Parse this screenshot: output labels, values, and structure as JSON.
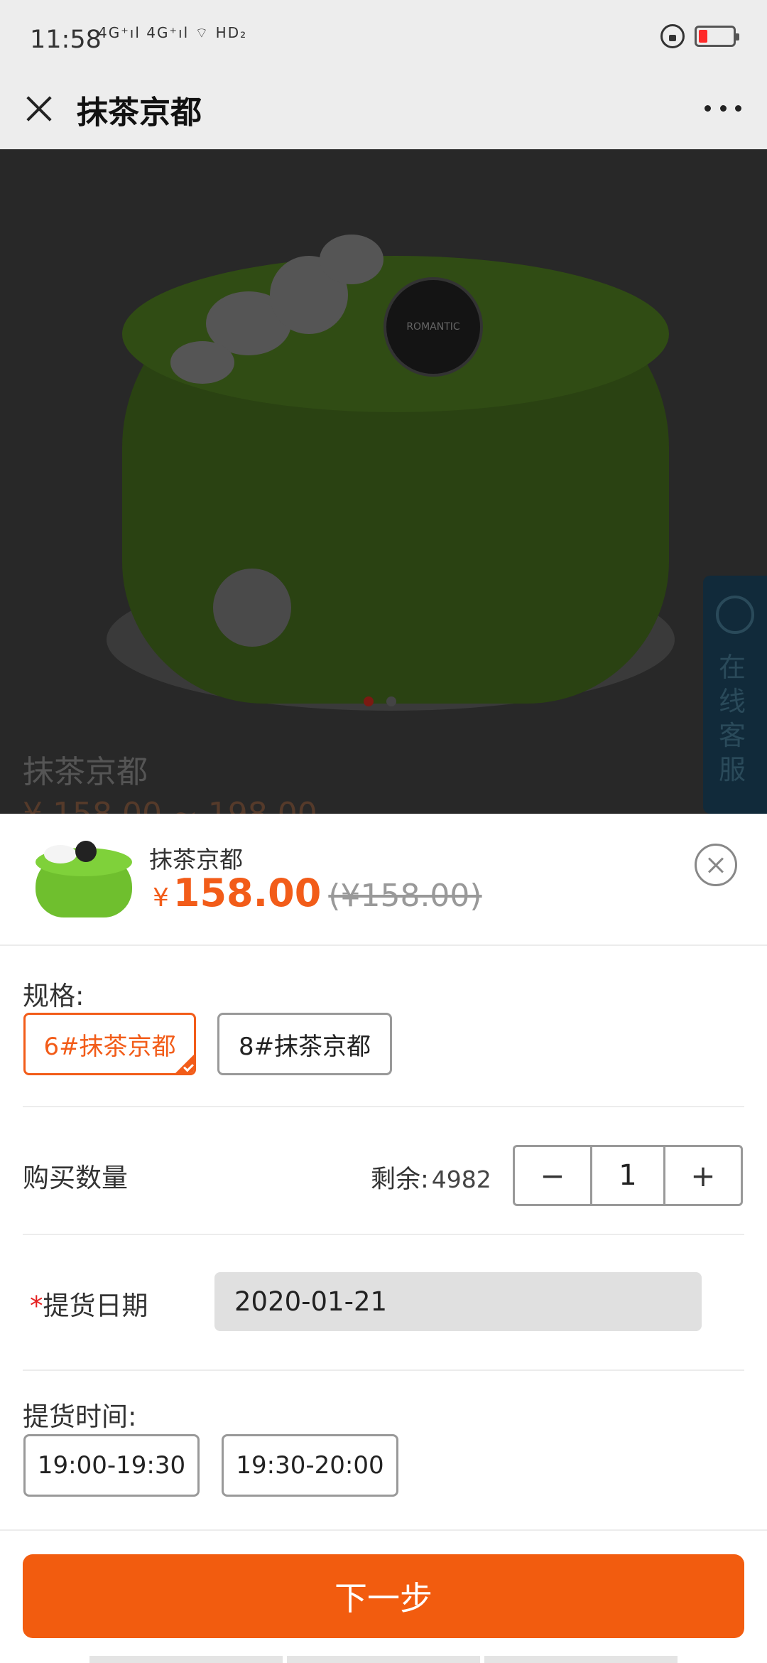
{
  "status_bar": {
    "time": "11:58",
    "signals": "4G⁺ıl 4G⁺ıl ⌔ HD₂",
    "battery_color": "#ff2a2a"
  },
  "header": {
    "title": "抹茶京都",
    "close_icon": "close-icon",
    "more_icon": "more-icon"
  },
  "hero": {
    "product_title": "抹茶京都",
    "price_partial": "¥ 158.00 ~ 198.00",
    "carousel_active_index": 0,
    "carousel_count": 2,
    "cake_logo_text": "ROMANTIC",
    "service_label": "在线客服"
  },
  "sheet": {
    "product_name": "抹茶京都",
    "currency": "¥",
    "price": "158.00",
    "original_price": "(¥158.00)",
    "spec_label": "规格:",
    "specs": [
      {
        "label": "6#抹茶京都",
        "selected": true
      },
      {
        "label": "8#抹茶京都",
        "selected": false
      }
    ],
    "quantity_label": "购买数量",
    "remaining_label": "剩余:",
    "remaining_value": "4982",
    "quantity_value": "1",
    "minus": "−",
    "plus": "+",
    "required_mark": "*",
    "date_label": "提货日期",
    "date_value": "2020-01-21",
    "time_label": "提货时间:",
    "time_slots": [
      "19:00-19:30",
      "19:30-20:00"
    ],
    "next_button": "下一步"
  },
  "colors": {
    "accent": "#f25c19",
    "button": "#f25c0f",
    "required": "#e52222"
  }
}
